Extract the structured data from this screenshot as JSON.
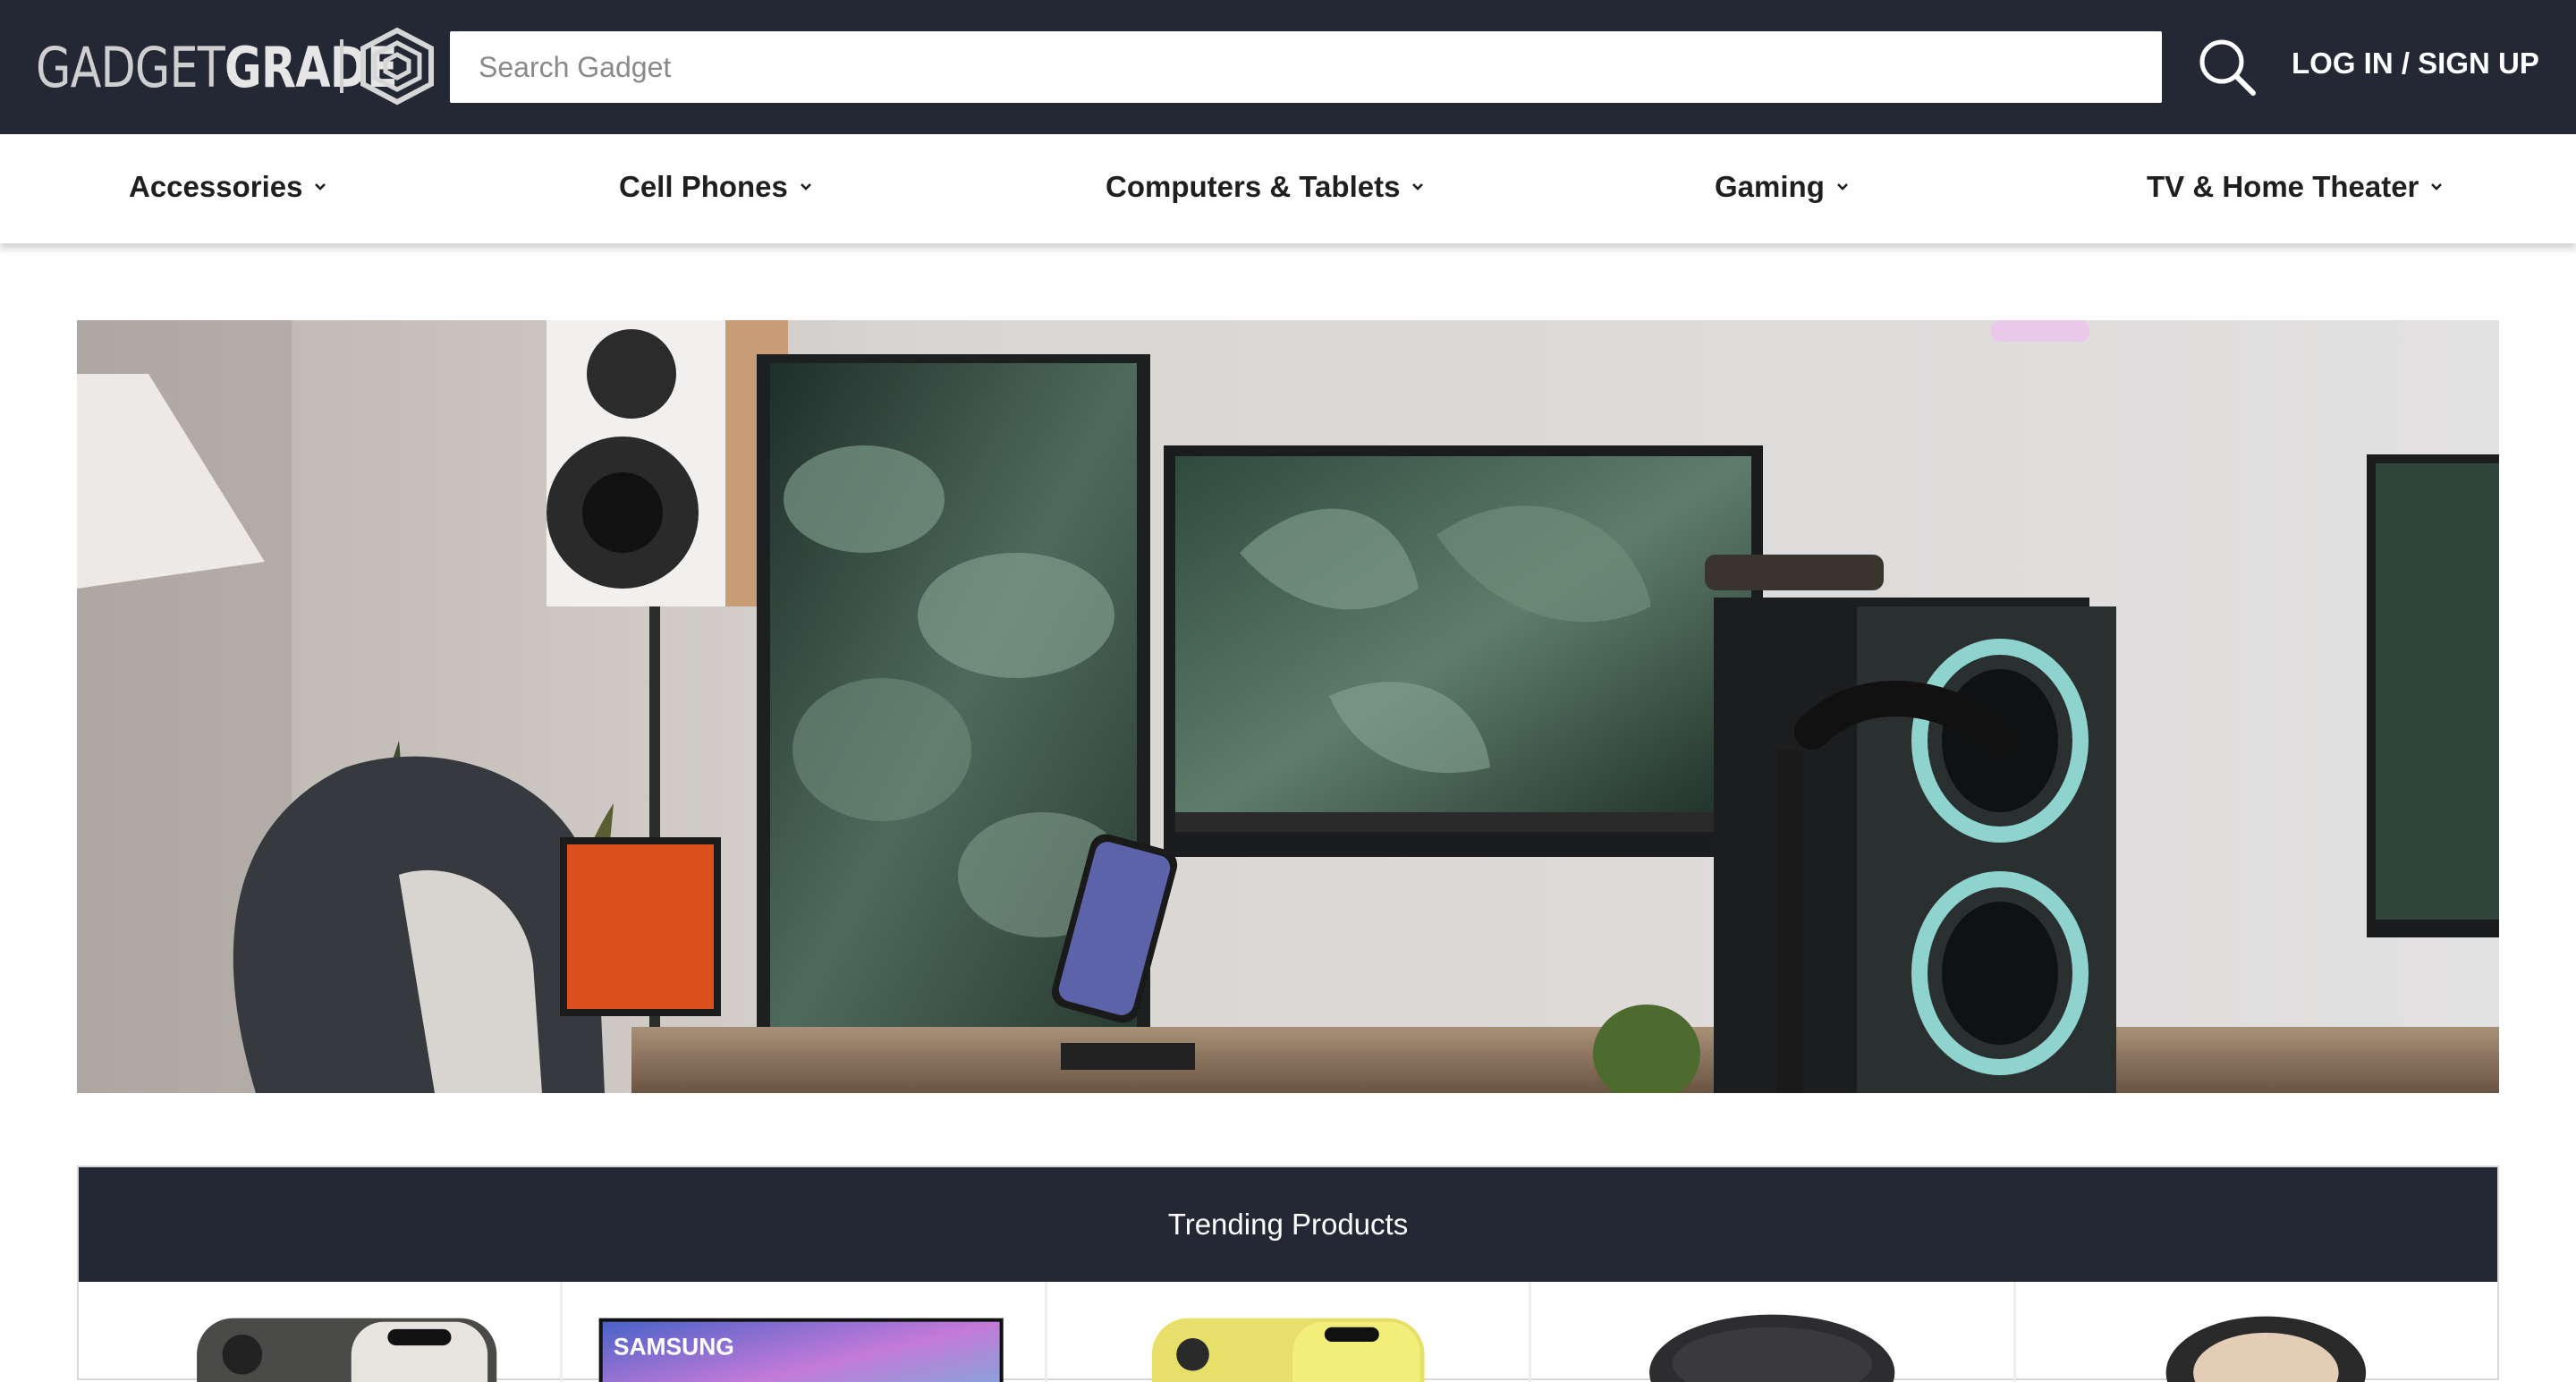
{
  "brand": {
    "logo_light": "GADGET",
    "logo_bold": "GRADE"
  },
  "header": {
    "search_placeholder": "Search Gadget",
    "login_label": "LOG IN / SIGN UP",
    "icons": [
      "hexagon-logo-icon",
      "search-icon"
    ]
  },
  "categories": [
    {
      "label": "Accessories",
      "icon": "chevron-down-icon"
    },
    {
      "label": "Cell Phones",
      "icon": "chevron-down-icon"
    },
    {
      "label": "Computers & Tablets",
      "icon": "chevron-down-icon"
    },
    {
      "label": "Gaming",
      "icon": "chevron-down-icon"
    },
    {
      "label": "TV & Home Theater",
      "icon": "chevron-down-icon"
    }
  ],
  "trending": {
    "title": "Trending Products",
    "products": [
      {
        "image": "phone-graphite-image"
      },
      {
        "image": "samsung-tv-image",
        "caption": "SAMSUNG"
      },
      {
        "image": "phone-yellow-image"
      },
      {
        "image": "black-speaker-image"
      },
      {
        "image": "beige-headphones-image"
      }
    ]
  },
  "colors": {
    "header_bg": "#242834",
    "accent_text": "#ffffff",
    "nav_text": "#1f1f1f"
  }
}
